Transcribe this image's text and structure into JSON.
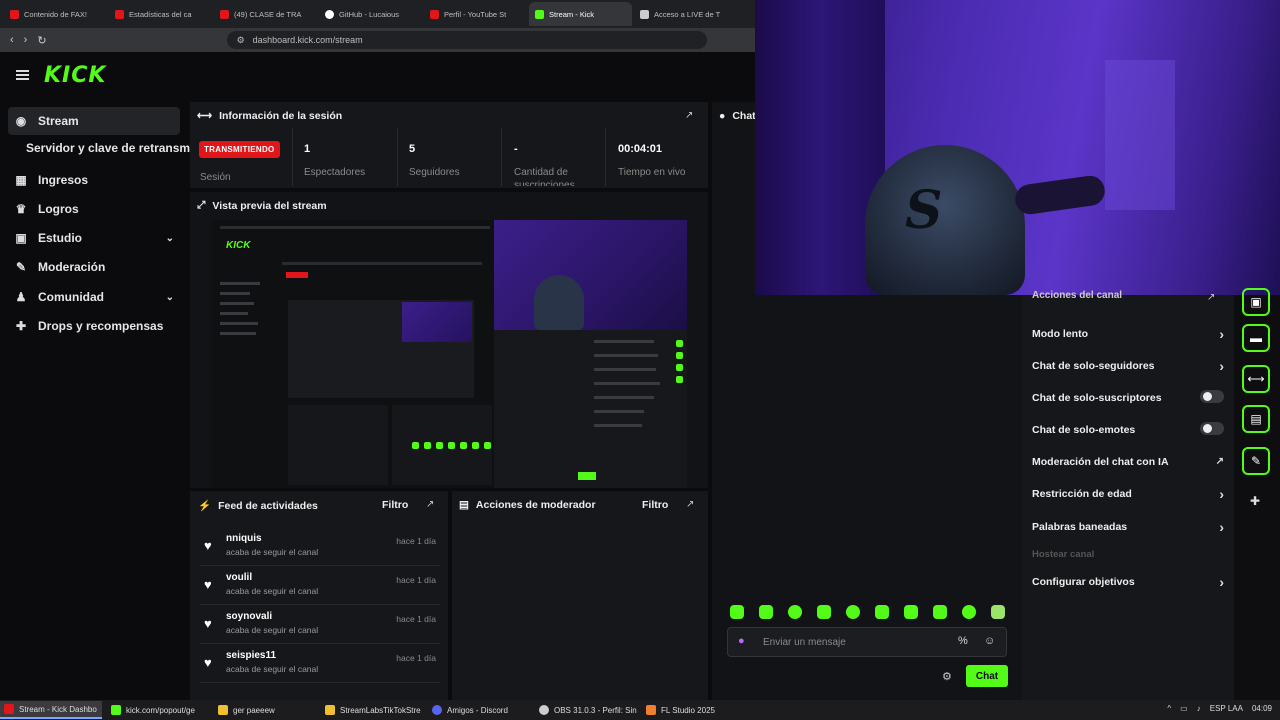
{
  "browser": {
    "tabs": [
      {
        "label": "Contenido de FAX!",
        "color": "#e0161b"
      },
      {
        "label": "Estadísticas del ca",
        "color": "#e0161b"
      },
      {
        "label": "(49) CLASE de TRA",
        "color": "#e0161b"
      },
      {
        "label": "GitHub - Lucaious",
        "color": "#ffffff"
      },
      {
        "label": "Perfil - YouTube St",
        "color": "#e0161b"
      },
      {
        "label": "Stream - Kick",
        "color": "#53fc18"
      },
      {
        "label": "Acceso a LIVE de T",
        "color": "#cccccc"
      }
    ],
    "active_tab_index": 5,
    "url": "dashboard.kick.com/stream"
  },
  "header": {
    "logo": "KICK"
  },
  "sidebar": {
    "items": [
      {
        "label": "Stream",
        "icon": "broadcast-icon",
        "glyph": "((·))"
      },
      {
        "label": "Ingresos",
        "icon": "chart-icon",
        "glyph": "▦"
      },
      {
        "label": "Logros",
        "icon": "trophy-icon",
        "glyph": "🏆"
      },
      {
        "label": "Estudio",
        "icon": "studio-icon",
        "glyph": "▣"
      },
      {
        "label": "Moderación",
        "icon": "wrench-icon",
        "glyph": "🔧"
      },
      {
        "label": "Comunidad",
        "icon": "community-icon",
        "glyph": "♟"
      },
      {
        "label": "Drops y recompensas",
        "icon": "gift-icon",
        "glyph": "🎁"
      }
    ],
    "subitem": "Servidor y clave de retransmisión"
  },
  "session": {
    "title": "Información de la sesión",
    "status_badge": "TRANSMITIENDO",
    "status_label": "Sesión",
    "stats": [
      {
        "value": "1",
        "label": "Espectadores"
      },
      {
        "value": "5",
        "label": "Seguidores"
      },
      {
        "value": "-",
        "label": "Cantidad de suscripciones"
      },
      {
        "value": "00:04:01",
        "label": "Tiempo en vivo"
      }
    ]
  },
  "preview": {
    "title": "Vista previa del stream"
  },
  "chat_title": "Chat",
  "feed": {
    "title": "Feed de actividades",
    "filter": "Filtro",
    "items": [
      {
        "user": "nniquis",
        "action": "acaba de seguir el canal",
        "time": "hace 1 día"
      },
      {
        "user": "voulil",
        "action": "acaba de seguir el canal",
        "time": "hace 1 día"
      },
      {
        "user": "soynovali",
        "action": "acaba de seguir el canal",
        "time": "hace 1 día"
      },
      {
        "user": "seispies11",
        "action": "acaba de seguir el canal",
        "time": "hace 1 día"
      }
    ]
  },
  "mod_actions": {
    "title": "Acciones de moderador",
    "filter": "Filtro"
  },
  "chat": {
    "placeholder": "Enviar un mensaje",
    "send": "Chat"
  },
  "settings": {
    "header": "Acciones del canal",
    "rows": [
      {
        "label": "Modo lento",
        "control": "arrow"
      },
      {
        "label": "Chat de solo-seguidores",
        "control": "arrow"
      },
      {
        "label": "Chat de solo-suscriptores",
        "control": "toggle"
      },
      {
        "label": "Chat de solo-emotes",
        "control": "toggle"
      },
      {
        "label": "Moderación del chat con IA",
        "control": "external"
      },
      {
        "label": "Restricción de edad",
        "control": "arrow"
      },
      {
        "label": "Palabras baneadas",
        "control": "arrow"
      },
      {
        "label": "Hostear canal",
        "control": "none"
      },
      {
        "label": "Configurar objetivos",
        "control": "arrow"
      }
    ]
  },
  "taskbar": {
    "items": [
      {
        "label": "Stream - Kick Dashbo",
        "color": "#e0161b"
      },
      {
        "label": "kick.com/popout/ge",
        "color": "#53fc18"
      },
      {
        "label": "ger paeeew",
        "color": "#f0c030"
      },
      {
        "label": "StreamLabsTikTokStre",
        "color": "#f0c030"
      },
      {
        "label": "Amigos - Discord",
        "color": "#5865f2"
      },
      {
        "label": "OBS 31.0.3 - Perfil: Sin",
        "color": "#cccccc"
      },
      {
        "label": "FL Studio 2025",
        "color": "#f08030"
      }
    ],
    "lang": "ESP",
    "lang2": "LAA",
    "time": "04:09"
  }
}
